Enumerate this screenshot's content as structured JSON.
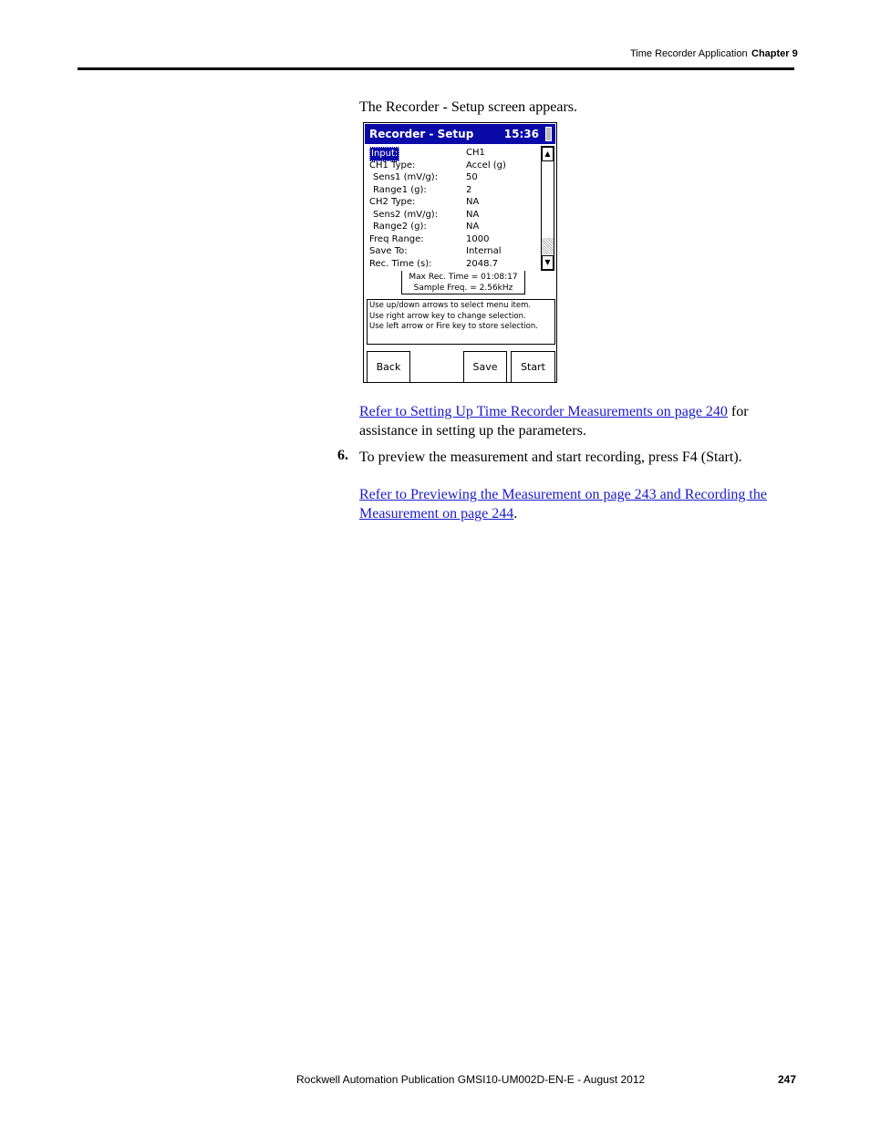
{
  "header": {
    "section": "Time Recorder Application",
    "chapter": "Chapter 9"
  },
  "intro": "The Recorder - Setup screen appears.",
  "device": {
    "title": "Recorder - Setup",
    "clock": "15:36",
    "fields": [
      {
        "label": "Input:",
        "value": "CH1"
      },
      {
        "label": "CH1 Type:",
        "value": "Accel (g)"
      },
      {
        "label": " Sens1 (mV/g):",
        "value": "50"
      },
      {
        "label": " Range1 (g):",
        "value": "2"
      },
      {
        "label": "CH2 Type:",
        "value": "NA"
      },
      {
        "label": " Sens2 (mV/g):",
        "value": "NA"
      },
      {
        "label": " Range2 (g):",
        "value": "NA"
      },
      {
        "label": "Freq Range:",
        "value": "1000"
      },
      {
        "label": "Save To:",
        "value": "Internal"
      },
      {
        "label": "Rec. Time (s):",
        "value": "2048.7"
      }
    ],
    "info_line1": "Max Rec. Time = 01:08:17",
    "info_line2": "Sample Freq. = 2.56kHz",
    "help_line1": "Use up/down arrows to select menu item.",
    "help_line2": "Use right arrow key to change selection.",
    "help_line3": "Use left arrow or Fire key to store selection.",
    "buttons": {
      "back": "Back",
      "save": "Save",
      "start": "Start"
    }
  },
  "ref1": {
    "link": "Refer to Setting Up Time Recorder Measurements on page 240",
    "tail": " for assistance in setting up the parameters."
  },
  "step": {
    "number": "6.",
    "text": "To preview the measurement and start recording, press F4 (Start)."
  },
  "ref2": {
    "link": "Refer to Previewing the Measurement on page 243 and Recording the Measurement on page 244",
    "tail": "."
  },
  "footer": {
    "publication": "Rockwell Automation Publication GMSI10-UM002D-EN-E - August 2012",
    "page": "247"
  }
}
